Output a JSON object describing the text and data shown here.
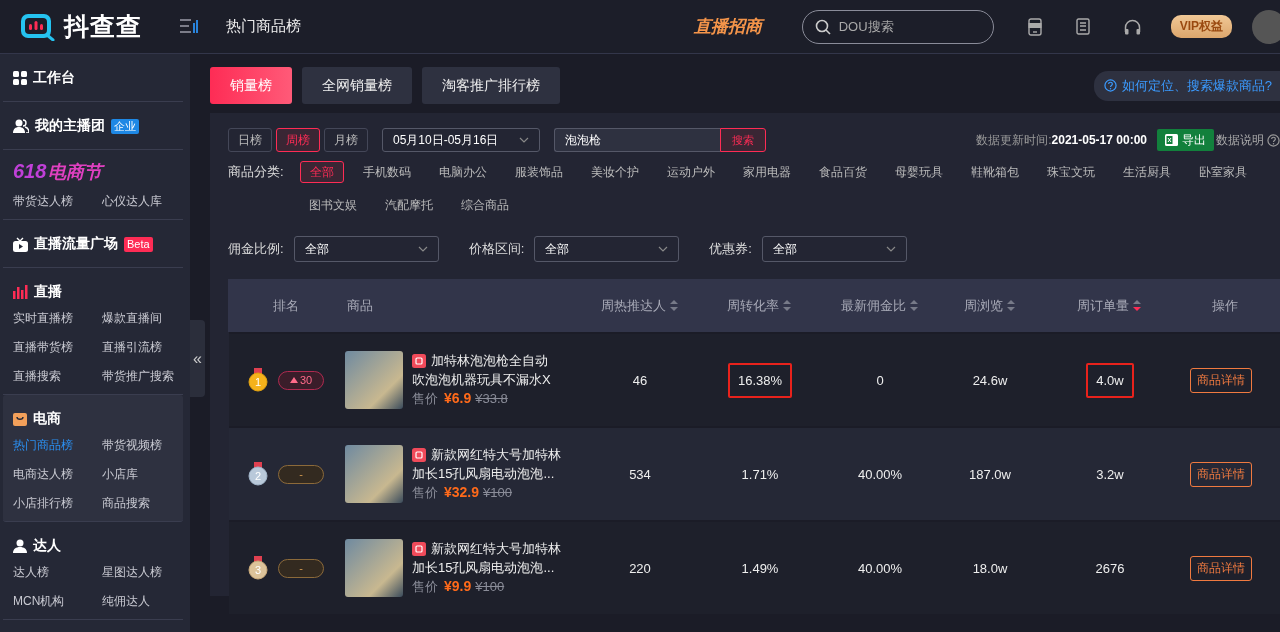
{
  "header": {
    "logo_text": "抖查查",
    "page_title": "热门商品榜",
    "promo": "直播招商",
    "search": {
      "placeholder": "DOU搜索"
    },
    "vip": "VIP权益"
  },
  "sidebar": {
    "sections": [
      {
        "kind": "link",
        "title": "工作台"
      },
      {
        "kind": "link",
        "title": "我的主播团",
        "badge": "企业"
      },
      {
        "kind": "festival",
        "logo_num": "618",
        "logo_text": "电商节",
        "items": [
          {
            "label": "带货达人榜",
            "selected": false
          },
          {
            "label": "心仪达人库",
            "selected": false
          }
        ]
      },
      {
        "kind": "link",
        "title": "直播流量广场",
        "badge": "Beta"
      },
      {
        "kind": "group",
        "title": "直播",
        "expanded": false,
        "items": [
          {
            "label": "实时直播榜",
            "selected": false
          },
          {
            "label": "爆款直播间",
            "selected": false
          },
          {
            "label": "直播带货榜",
            "selected": false
          },
          {
            "label": "直播引流榜",
            "selected": false
          },
          {
            "label": "直播搜索",
            "selected": false
          },
          {
            "label": "带货推广搜索",
            "selected": false
          }
        ]
      },
      {
        "kind": "group",
        "title": "电商",
        "expanded": true,
        "items": [
          {
            "label": "热门商品榜",
            "selected": true
          },
          {
            "label": "带货视频榜",
            "selected": false
          },
          {
            "label": "电商达人榜",
            "selected": false
          },
          {
            "label": "小店库",
            "selected": false
          },
          {
            "label": "小店排行榜",
            "selected": false
          },
          {
            "label": "商品搜索",
            "selected": false
          }
        ]
      },
      {
        "kind": "group",
        "title": "达人",
        "expanded": false,
        "items": [
          {
            "label": "达人榜",
            "selected": false
          },
          {
            "label": "星图达人榜",
            "selected": false
          },
          {
            "label": "MCN机构",
            "selected": false
          },
          {
            "label": "纯佣达人",
            "selected": false
          }
        ]
      }
    ]
  },
  "collapse_handle": "«",
  "tabs": [
    {
      "label": "销量榜",
      "selected": true
    },
    {
      "label": "全网销量榜",
      "selected": false
    },
    {
      "label": "淘客推广排行榜",
      "selected": false
    }
  ],
  "help_link": "如何定位、搜索爆款商品?",
  "filters": {
    "periods": [
      {
        "label": "日榜",
        "selected": false
      },
      {
        "label": "周榜",
        "selected": true
      },
      {
        "label": "月榜",
        "selected": false
      }
    ],
    "date_range": "05月10日-05月16日",
    "keyword": "泡泡枪",
    "search_button": "搜索",
    "update_time": "数据更新时间:**2021-05-17 00:00**",
    "export_button": "导出",
    "data_note": "数据说明",
    "category_label": "商品分类:",
    "categories": [
      {
        "label": "全部",
        "selected": true
      },
      {
        "label": "手机数码",
        "selected": false
      },
      {
        "label": "电脑办公",
        "selected": false
      },
      {
        "label": "服装饰品",
        "selected": false
      },
      {
        "label": "美妆个护",
        "selected": false
      },
      {
        "label": "运动户外",
        "selected": false
      },
      {
        "label": "家用电器",
        "selected": false
      },
      {
        "label": "食品百货",
        "selected": false
      },
      {
        "label": "母婴玩具",
        "selected": false
      },
      {
        "label": "鞋靴箱包",
        "selected": false
      },
      {
        "label": "珠宝文玩",
        "selected": false
      },
      {
        "label": "生活厨具",
        "selected": false
      },
      {
        "label": "卧室家具",
        "selected": false
      },
      {
        "label": "图书文娱",
        "selected": false
      },
      {
        "label": "汽配摩托",
        "selected": false
      },
      {
        "label": "综合商品",
        "selected": false
      }
    ],
    "selects": [
      {
        "label": "佣金比例:",
        "value": "全部"
      },
      {
        "label": "价格区间:",
        "value": "全部"
      },
      {
        "label": "优惠券:",
        "value": "全部"
      }
    ]
  },
  "table": {
    "columns": [
      {
        "label": "排名"
      },
      {
        "label": "商品"
      },
      {
        "label": "周热推达人",
        "sortable": true,
        "sort_active": false
      },
      {
        "label": "周转化率",
        "sortable": true,
        "sort_active": false
      },
      {
        "label": "最新佣金比",
        "sortable": true,
        "sort_active": false
      },
      {
        "label": "周浏览",
        "sortable": true,
        "sort_active": false
      },
      {
        "label": "周订单量",
        "sortable": true,
        "sort_active": true
      },
      {
        "label": "操作"
      }
    ],
    "rows": [
      {
        "rank": "1",
        "change": "30",
        "rank_up": true,
        "title_lines": [
          "加特林泡泡枪全自动",
          "吹泡泡机器玩具不漏水X"
        ],
        "price_label": "售价",
        "price": "¥6.9",
        "original_price": "¥33.8",
        "metrics": [
          {
            "text": "46",
            "highlighted": false
          },
          {
            "text": "16.38%",
            "highlighted": true
          },
          {
            "text": "0",
            "highlighted": false
          },
          {
            "text": "24.6w",
            "highlighted": false
          },
          {
            "text": "4.0w",
            "highlighted": true
          }
        ],
        "action": "商品详情"
      },
      {
        "rank": "2",
        "change": "-",
        "rank_up": false,
        "title_lines": [
          "新款网红特大号加特林",
          "加长15孔风扇电动泡泡..."
        ],
        "price_label": "售价",
        "price": "¥32.9",
        "original_price": "¥100",
        "metrics": [
          {
            "text": "534",
            "highlighted": false
          },
          {
            "text": "1.71%",
            "highlighted": false
          },
          {
            "text": "40.00%",
            "highlighted": false
          },
          {
            "text": "187.0w",
            "highlighted": false
          },
          {
            "text": "3.2w",
            "highlighted": false
          }
        ],
        "action": "商品详情"
      },
      {
        "rank": "3",
        "change": "-",
        "rank_up": false,
        "title_lines": [
          "新款网红特大号加特林",
          "加长15孔风扇电动泡泡..."
        ],
        "price_label": "售价",
        "price": "¥9.9",
        "original_price": "¥100",
        "metrics": [
          {
            "text": "220",
            "highlighted": false
          },
          {
            "text": "1.49%",
            "highlighted": false
          },
          {
            "text": "40.00%",
            "highlighted": false
          },
          {
            "text": "18.0w",
            "highlighted": false
          },
          {
            "text": "2676",
            "highlighted": false
          }
        ],
        "action": "商品详情"
      }
    ]
  }
}
